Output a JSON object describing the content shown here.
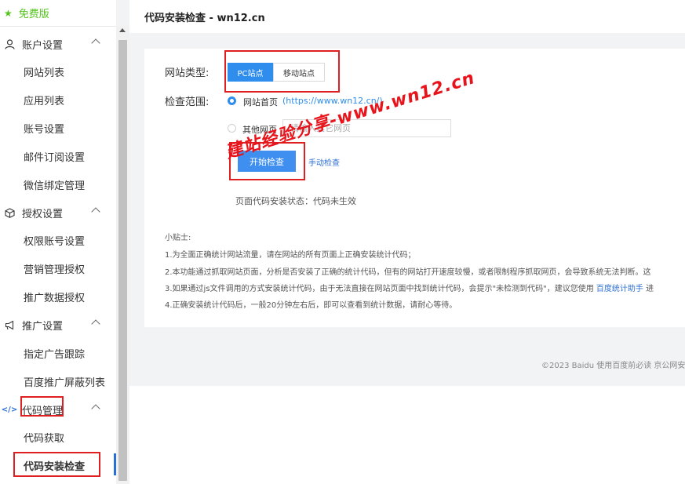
{
  "sidebar": {
    "free_version": "免费版",
    "groups": [
      {
        "label": "账户设置",
        "icon": "user-icon",
        "items": [
          "网站列表",
          "应用列表",
          "账号设置",
          "邮件订阅设置",
          "微信绑定管理"
        ]
      },
      {
        "label": "授权设置",
        "icon": "cube-icon",
        "items": [
          "权限账号设置",
          "营销管理授权",
          "推广数据授权"
        ]
      },
      {
        "label": "推广设置",
        "icon": "megaphone-icon",
        "items": [
          "指定广告跟踪",
          "百度推广屏蔽列表"
        ]
      },
      {
        "label": "代码管理",
        "icon": "code-icon",
        "items": [
          "代码获取",
          "代码安装检查"
        ]
      }
    ],
    "active_item": "代码安装检查"
  },
  "header": {
    "title": "代码安装检查 - wn12.cn"
  },
  "form": {
    "site_type_label": "网站类型:",
    "site_type_options": [
      "PC站点",
      "移动站点"
    ],
    "site_type_selected": "PC站点",
    "scope_label": "检查范围:",
    "scope_home_label": "网站首页",
    "scope_home_url": "(https://www.wn12.cn/)",
    "scope_other_label": "其他网页",
    "scope_other_placeholder": "请输入其它网页",
    "start_button": "开始检查",
    "manual_link": "手动检查",
    "status": "页面代码安装状态：代码未生效"
  },
  "tips": {
    "title": "小贴士:",
    "line1": "1.为全面正确统计网站流量，请在网站的所有页面上正确安装统计代码；",
    "line2": "2.本功能通过抓取网站页面，分析是否安装了正确的统计代码，但有的网站打开速度较慢，或者限制程序抓取网页，会导致系统无法判断。这",
    "line3_a": "3.如果通过js文件调用的方式安装统计代码，由于无法直接在网站页面中找到统计代码，会提示\"未检测到代码\"，建议您使用",
    "line3_link": "百度统计助手",
    "line3_b": "进",
    "line4": "4.正确安装统计代码后，一般20分钟左右后，即可以查看到统计数据，请耐心等待。"
  },
  "footer": {
    "text": "©2023 Baidu 使用百度前必读 京公网安"
  },
  "watermark": "建站经验分享-www.wn12.cn",
  "colors": {
    "accent": "#2e8ded",
    "highlight_box": "#e02020",
    "free_green": "#52c41a"
  }
}
